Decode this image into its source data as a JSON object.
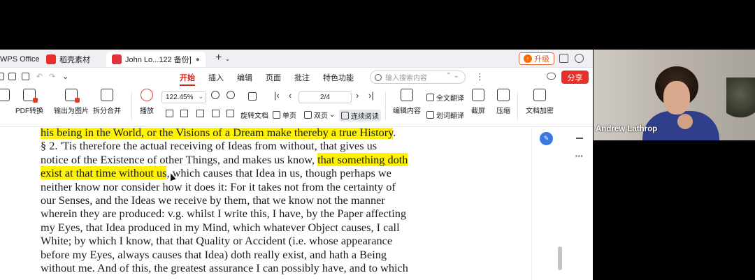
{
  "tabs": [
    {
      "label": "WPS Office"
    },
    {
      "label": "稻壳素材"
    },
    {
      "label": "John Lo...122 备份]"
    }
  ],
  "window": {
    "upgrade_label": "升级"
  },
  "menu": {
    "items": [
      "开始",
      "插入",
      "编辑",
      "页面",
      "批注",
      "特色功能"
    ],
    "search_placeholder": "输入搜索内容",
    "share_label": "分享"
  },
  "toolbar": {
    "pdf_convert": "PDF转换",
    "export_image": "输出为图片",
    "split_merge": "拆分合并",
    "play": "播放",
    "zoom": "122.45%",
    "rotate": "旋转文档",
    "single_page": "单页",
    "double_page": "双页",
    "continuous": "连续阅读",
    "page_indicator": "2/4",
    "edit_content": "编辑内容",
    "full_translate": "全文翻译",
    "word_translate": "划词翻译",
    "screenshot": "截屏",
    "compress": "压缩",
    "encrypt": "文档加密"
  },
  "document": {
    "lines": [
      {
        "segments": [
          {
            "text": "his being in the World, or the Visions of a Dream make thereby a true History",
            "hl": true
          },
          {
            "text": ".",
            "hl": false
          }
        ]
      },
      {
        "segments": [
          {
            "text": "§ 2. 'Tis therefore the actual receiving of Ideas from without, that gives us",
            "hl": false
          }
        ]
      },
      {
        "segments": [
          {
            "text": "notice of the Existence of other Things, and makes us know, ",
            "hl": false
          },
          {
            "text": "that something doth",
            "hl": true
          }
        ]
      },
      {
        "segments": [
          {
            "text": "exist at that time without us",
            "hl": true
          },
          {
            "text": ", which causes that Idea in us, though perhaps we",
            "hl": false
          }
        ]
      },
      {
        "segments": [
          {
            "text": "neither know nor consider how it does it: For it takes not from the certainty of",
            "hl": false
          }
        ]
      },
      {
        "segments": [
          {
            "text": "our Senses, and the Ideas we receive by them, that we know not the manner",
            "hl": false
          }
        ]
      },
      {
        "segments": [
          {
            "text": "wherein they are produced: v.g. whilst I write this, I have, by the Paper affecting",
            "hl": false
          }
        ]
      },
      {
        "segments": [
          {
            "text": "my Eyes, that Idea produced in my Mind, which whatever Object causes, I call",
            "hl": false
          }
        ]
      },
      {
        "segments": [
          {
            "text": "White; by which I know, that that Quality or Accident (i.e. whose appearance",
            "hl": false
          }
        ]
      },
      {
        "segments": [
          {
            "text": "before my Eyes, always causes that Idea) doth really exist, and hath a Being",
            "hl": false
          }
        ]
      },
      {
        "segments": [
          {
            "text": "without me. And of this, the greatest assurance I can possibly have, and to which",
            "hl": false
          }
        ]
      }
    ]
  },
  "webcam": {
    "participant_name": "Andrew Lathrop"
  },
  "colors": {
    "accent": "#d6261c",
    "highlight": "#fff200",
    "share": "#e8302a"
  }
}
